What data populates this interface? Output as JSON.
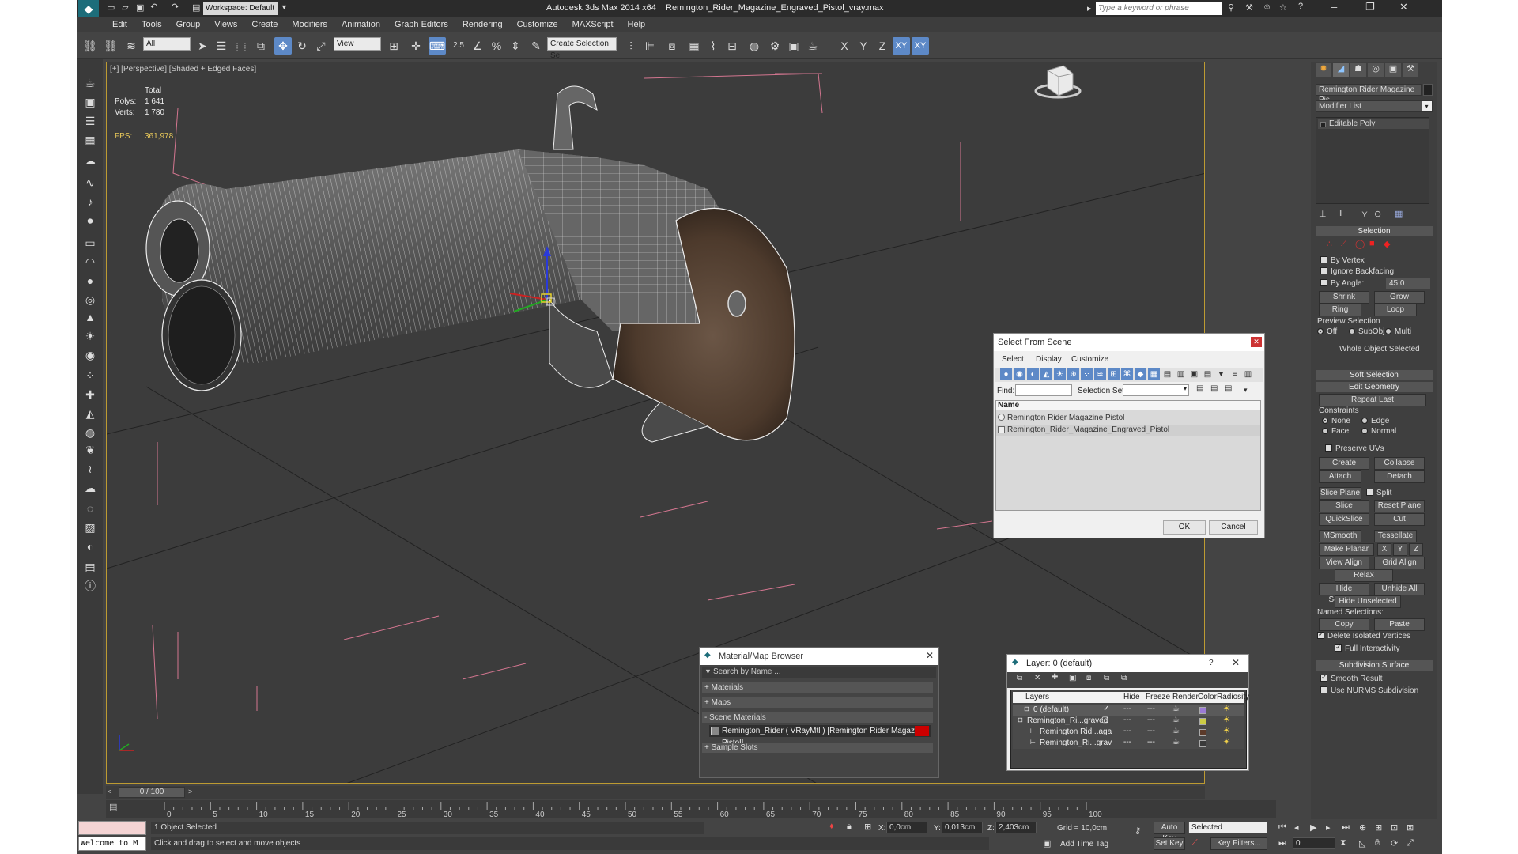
{
  "window": {
    "app": "Autodesk 3ds Max  2014 x64",
    "file": "Remington_Rider_Magazine_Engraved_Pistol_vray.max",
    "workspace": "Workspace: Default",
    "search_placeholder": "Type a keyword or phrase"
  },
  "menu": [
    "Edit",
    "Tools",
    "Group",
    "Views",
    "Create",
    "Modifiers",
    "Animation",
    "Graph Editors",
    "Rendering",
    "Customize",
    "MAXScript",
    "Help"
  ],
  "toolbar": {
    "filter": "All",
    "refcoord": "View",
    "selset": "Create Selection Se",
    "snap_angle": "2.5",
    "axes": [
      "X",
      "Y",
      "Z",
      "XY",
      "XY"
    ]
  },
  "viewport": {
    "label": "[+] [Perspective] [Shaded + Edged Faces]",
    "stats": {
      "total": "Total",
      "polys_label": "Polys:",
      "polys": "1 641",
      "verts_label": "Verts:",
      "verts": "1 780",
      "fps_label": "FPS:",
      "fps": "361,978"
    }
  },
  "cmd_panel": {
    "object_name": "Remington Rider Magazine Pis",
    "modifier_list": "Modifier List",
    "stack_item": "Editable Poly",
    "selection": {
      "title": "Selection",
      "by_vertex": "By Vertex",
      "ignore_backfacing": "Ignore Backfacing",
      "by_angle": "By Angle:",
      "angle": "45,0",
      "shrink": "Shrink",
      "grow": "Grow",
      "ring": "Ring",
      "loop": "Loop",
      "preview": "Preview Selection",
      "off": "Off",
      "subobj": "SubObj",
      "multi": "Multi",
      "whole": "Whole Object Selected"
    },
    "soft_selection": "Soft Selection",
    "edit_geometry": {
      "title": "Edit Geometry",
      "repeat_last": "Repeat Last",
      "constraints": "Constraints",
      "none": "None",
      "edge": "Edge",
      "face": "Face",
      "normal": "Normal",
      "preserve_uvs": "Preserve UVs",
      "create": "Create",
      "collapse": "Collapse",
      "attach": "Attach",
      "detach": "Detach",
      "slice_plane": "Slice Plane",
      "split": "Split",
      "slice": "Slice",
      "reset_plane": "Reset Plane",
      "quickslice": "QuickSlice",
      "cut": "Cut",
      "msmooth": "MSmooth",
      "tessellate": "Tessellate",
      "make_planar": "Make Planar",
      "x": "X",
      "y": "Y",
      "z": "Z",
      "view_align": "View Align",
      "grid_align": "Grid Align",
      "relax": "Relax",
      "hide_selected": "Hide Selected",
      "unhide_all": "Unhide All",
      "hide_unselected": "Hide Unselected",
      "named_selections": "Named Selections:",
      "copy": "Copy",
      "paste": "Paste",
      "delete_isolated": "Delete Isolated Vertices",
      "full_interactivity": "Full Interactivity"
    },
    "subdivision": {
      "title": "Subdivision Surface",
      "smooth_result": "Smooth Result",
      "use_nurms": "Use NURMS Subdivision"
    }
  },
  "select_dialog": {
    "title": "Select From Scene",
    "tabs": [
      "Select",
      "Display",
      "Customize"
    ],
    "find": "Find:",
    "selection_set": "Selection Set:",
    "column": "Name",
    "items": [
      "Remington Rider Magazine Pistol",
      "Remington_Rider_Magazine_Engraved_Pistol"
    ],
    "ok": "OK",
    "cancel": "Cancel"
  },
  "material_browser": {
    "title": "Material/Map Browser",
    "search": "Search by Name ...",
    "sections": [
      "+ Materials",
      "+ Maps",
      "- Scene Materials",
      "+ Sample Slots"
    ],
    "material": "Remington_Rider  ( VRayMtl ) [Remington Rider Magazine Pistol]",
    "swatch": "#cc0000"
  },
  "layer_dialog": {
    "title": "Layer: 0 (default)",
    "help": "?",
    "columns": [
      "Layers",
      "Hide",
      "Freeze",
      "Render",
      "Color",
      "Radiosity"
    ],
    "rows": [
      {
        "name": "0 (default)",
        "color": "#9b7bd4"
      },
      {
        "name": "Remington_Ri...graved",
        "color": "#cccc44"
      },
      {
        "name": "Remington Rid...aga",
        "color": "#5b3a2a"
      },
      {
        "name": "Remington_Ri...grav",
        "color": "#3a3a3a"
      }
    ]
  },
  "timeline": {
    "frame": "0 / 100",
    "ticks": [
      "0",
      "5",
      "10",
      "15",
      "20",
      "25",
      "30",
      "35",
      "40",
      "45",
      "50",
      "55",
      "60",
      "65",
      "70",
      "75",
      "80",
      "85",
      "90",
      "95",
      "100"
    ]
  },
  "status": {
    "maxscript": "Welcome to M",
    "selected": "1 Object Selected",
    "prompt": "Click and drag to select and move objects",
    "x_label": "X:",
    "x": "0,0cm",
    "y_label": "Y:",
    "y": "0,013cm",
    "z_label": "Z:",
    "z": "2,403cm",
    "grid": "Grid = 10,0cm",
    "autokey": "Auto Key",
    "selected_dd": "Selected",
    "setkey": "Set Key",
    "keyfilters": "Key Filters...",
    "add_time_tag": "Add Time Tag",
    "frame_field": "0"
  }
}
